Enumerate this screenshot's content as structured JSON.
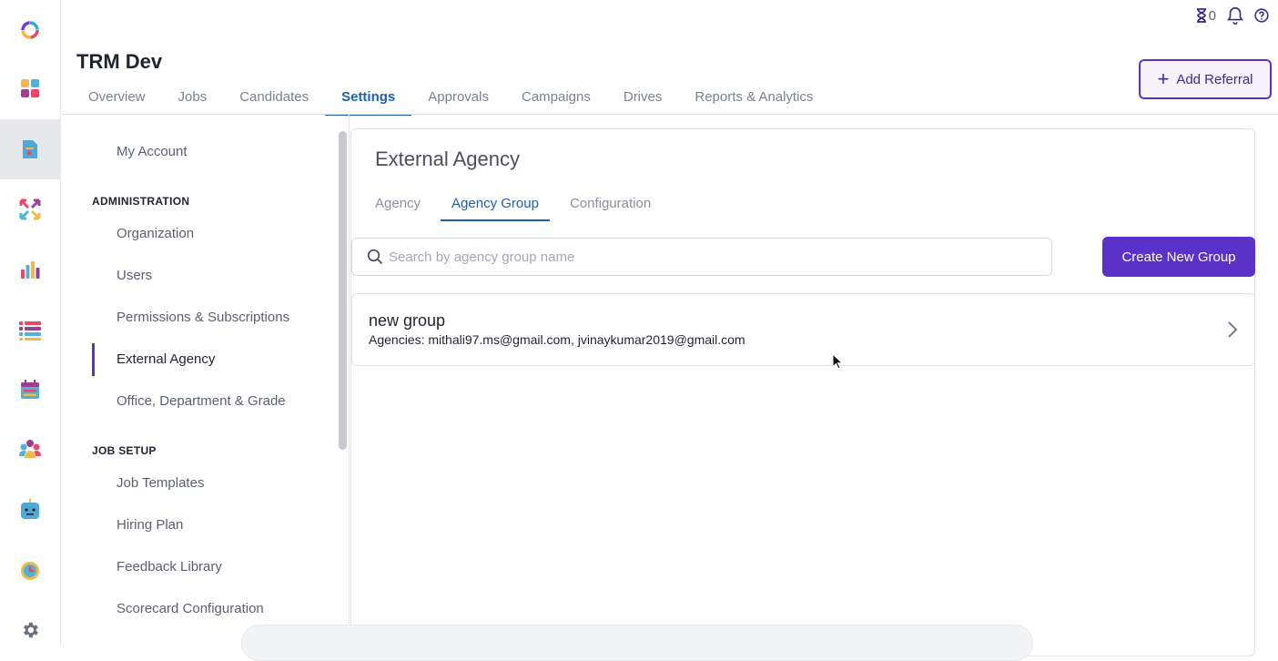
{
  "app": {
    "title": "TRM Dev"
  },
  "topbar": {
    "pending_count": "0"
  },
  "header": {
    "add_referral_label": "Add Referral"
  },
  "main_tabs": [
    {
      "label": "Overview"
    },
    {
      "label": "Jobs"
    },
    {
      "label": "Candidates"
    },
    {
      "label": "Settings"
    },
    {
      "label": "Approvals"
    },
    {
      "label": "Campaigns"
    },
    {
      "label": "Drives"
    },
    {
      "label": "Reports & Analytics"
    }
  ],
  "settings_nav": {
    "my_account": "My Account",
    "administration": {
      "heading": "ADMINISTRATION",
      "items": [
        {
          "label": "Organization"
        },
        {
          "label": "Users"
        },
        {
          "label": "Permissions & Subscriptions"
        },
        {
          "label": "External Agency"
        },
        {
          "label": "Office, Department & Grade"
        }
      ]
    },
    "job_setup": {
      "heading": "JOB SETUP",
      "items": [
        {
          "label": "Job Templates"
        },
        {
          "label": "Hiring Plan"
        },
        {
          "label": "Feedback Library"
        },
        {
          "label": "Scorecard Configuration"
        }
      ]
    }
  },
  "panel": {
    "title": "External Agency",
    "tabs": [
      {
        "label": "Agency"
      },
      {
        "label": "Agency Group"
      },
      {
        "label": "Configuration"
      }
    ],
    "search": {
      "placeholder": "Search by agency group name",
      "value": ""
    },
    "create_button": "Create New Group",
    "groups": [
      {
        "name": "new group",
        "agencies": "Agencies: mithali97.ms@gmail.com, jvinaykumar2019@gmail.com"
      }
    ]
  },
  "colors": {
    "accent": "#5b32c9",
    "active_tab": "#1c5fb0"
  }
}
